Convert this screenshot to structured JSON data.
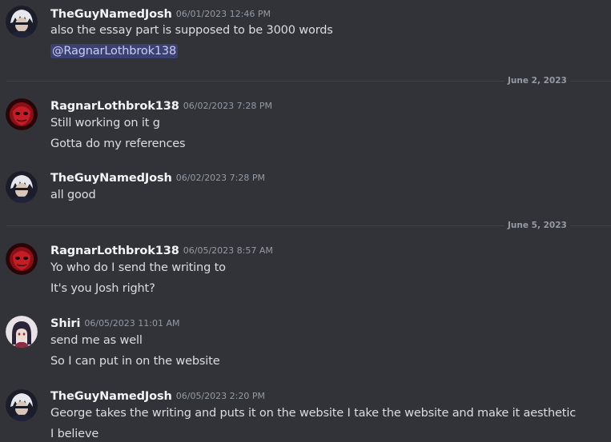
{
  "messages": [
    {
      "username": "TheGuyNamedJosh",
      "timestamp": "06/01/2023 12:46 PM",
      "avatar_icon": "white-haired-character-avatar",
      "lines": [
        "also the essay part is supposed to be 3000 words"
      ],
      "mention": "@RagnarLothbrok138"
    },
    {
      "username": "RagnarLothbrok138",
      "timestamp": "06/02/2023 7:28 PM",
      "avatar_icon": "red-mask-avatar",
      "lines": [
        "Still working on it g",
        "Gotta do my references"
      ]
    },
    {
      "username": "TheGuyNamedJosh",
      "timestamp": "06/02/2023 7:28 PM",
      "avatar_icon": "white-haired-character-avatar",
      "lines": [
        "all good"
      ]
    },
    {
      "username": "RagnarLothbrok138",
      "timestamp": "06/05/2023 8:57 AM",
      "avatar_icon": "red-mask-avatar",
      "lines": [
        "Yo who do I send the writing to",
        "It's you Josh right?"
      ]
    },
    {
      "username": "Shiri",
      "timestamp": "06/05/2023 11:01 AM",
      "avatar_icon": "anime-girl-avatar",
      "lines": [
        "send me as well",
        "So I can put in on the website"
      ]
    },
    {
      "username": "TheGuyNamedJosh",
      "timestamp": "06/05/2023 2:20 PM",
      "avatar_icon": "white-haired-character-avatar",
      "lines": [
        "George takes the writing and puts it on the website I take the website and make it aesthetic",
        "I believe"
      ]
    }
  ],
  "dividers": [
    {
      "label": "June 2, 2023"
    },
    {
      "label": "June 5, 2023"
    }
  ],
  "colors": {
    "background": "#313338",
    "username": "#f2f3f5",
    "text": "#dbdee1",
    "muted": "#949ba4",
    "mention_bg": "#5865f24d",
    "mention_text": "#c9cdfb"
  }
}
